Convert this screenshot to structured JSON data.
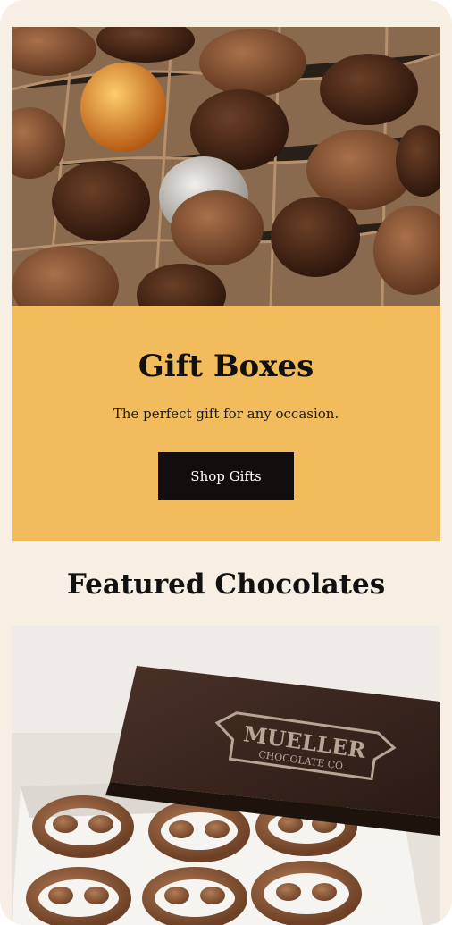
{
  "hero": {
    "title": "Gift Boxes",
    "subtitle": "The perfect gift for any occasion.",
    "button_label": "Shop Gifts",
    "panel_color": "#f2bb5c",
    "button_color": "#140d0e"
  },
  "featured": {
    "title": "Featured Chocolates",
    "box_brand": "MUELLER",
    "box_sub": "CHOCOLATE CO."
  },
  "colors": {
    "page_bg": "#f7efe3"
  }
}
